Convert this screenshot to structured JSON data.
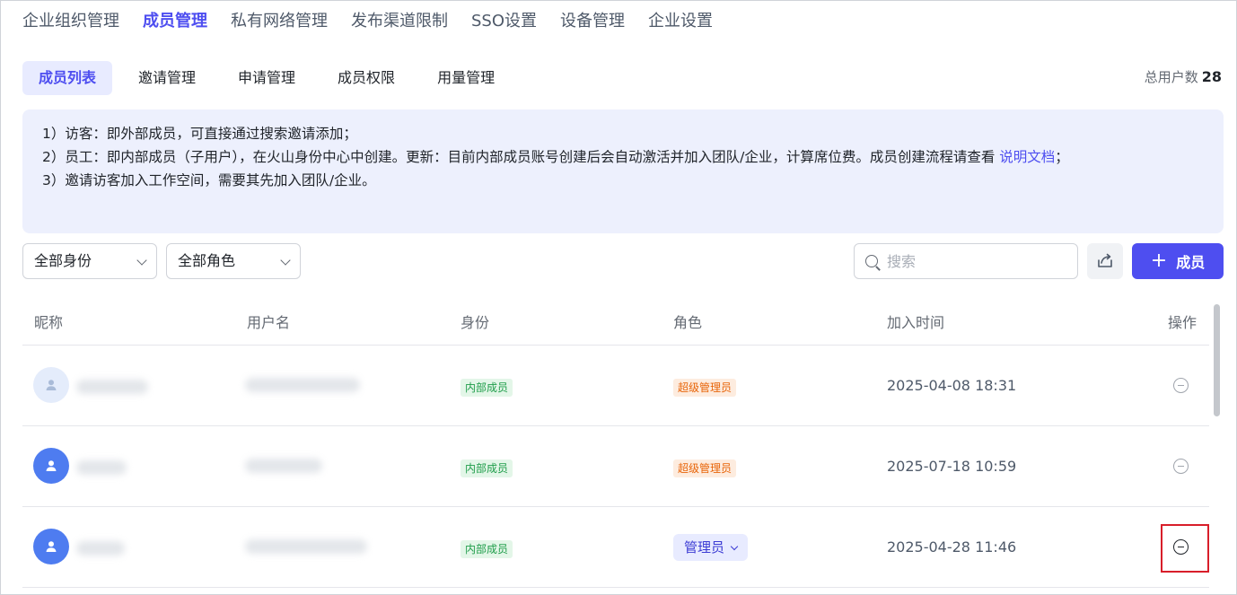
{
  "topnav": {
    "items": [
      "企业组织管理",
      "成员管理",
      "私有网络管理",
      "发布渠道限制",
      "SSO设置",
      "设备管理",
      "企业设置"
    ],
    "active_index": 1
  },
  "subtabs": {
    "items": [
      "成员列表",
      "邀请管理",
      "申请管理",
      "成员权限",
      "用量管理"
    ],
    "active_index": 0
  },
  "user_count": {
    "label": "总用户数",
    "value": "28"
  },
  "notice": {
    "line1": "1）访客：即外部成员，可直接通过搜索邀请添加；",
    "line2_text": "2）员工：即内部成员（子用户），在火山身份中心中创建。更新：目前内部成员账号创建后会自动激活并加入团队/企业，计算席位费。成员创建流程请查看 ",
    "line2_link": "说明文档",
    "line2_end": "；",
    "line3": "3）邀请访客加入工作空间，需要其先加入团队/企业。"
  },
  "filters": {
    "identity": "全部身份",
    "role": "全部角色",
    "search_placeholder": "搜索"
  },
  "toolbar": {
    "add_label": "成员",
    "add_icon": "plus-icon",
    "export_icon": "export-icon"
  },
  "table": {
    "headers": [
      "昵称",
      "用户名",
      "身份",
      "角色",
      "加入时间",
      "操作"
    ],
    "rows": [
      {
        "identity": "内部成员",
        "role": "超级管理员",
        "role_type": "tag",
        "joined": "2025-04-08 18:31"
      },
      {
        "identity": "内部成员",
        "role": "超级管理员",
        "role_type": "tag",
        "joined": "2025-07-18 10:59"
      },
      {
        "identity": "内部成员",
        "role": "管理员",
        "role_type": "select",
        "joined": "2025-04-28 11:46"
      }
    ]
  },
  "colors": {
    "accent": "#4e4ef0",
    "highlight": "#d81e2a"
  }
}
